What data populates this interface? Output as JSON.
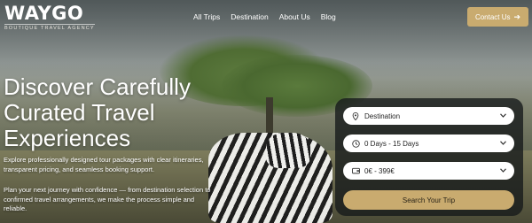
{
  "brand": {
    "name": "WAYGO",
    "tagline": "BOUTIQUE TRAVEL AGENCY"
  },
  "nav": {
    "items": [
      {
        "label": "All Trips"
      },
      {
        "label": "Destination"
      },
      {
        "label": "About Us"
      },
      {
        "label": "Blog"
      }
    ]
  },
  "contact": {
    "label": "Contact Us",
    "icon": "arrow-right-icon"
  },
  "hero": {
    "headline": "Discover Carefully Curated Travel Experiences",
    "paragraph1": "Explore professionally designed tour packages with clear itineraries, transparent pricing, and seamless booking support.",
    "paragraph2": "Plan your next journey with confidence — from destination selection to confirmed travel arrangements, we make the process simple and reliable."
  },
  "booking": {
    "destination": {
      "label": "Destination",
      "icon": "location-pin-icon"
    },
    "duration": {
      "label": "0 Days - 15 Days",
      "icon": "clock-icon"
    },
    "budget": {
      "label": "0€ - 399€",
      "icon": "wallet-icon"
    },
    "search_label": "Search Your Trip"
  },
  "colors": {
    "accent": "#c9ab6f",
    "panel": "#14181a"
  }
}
